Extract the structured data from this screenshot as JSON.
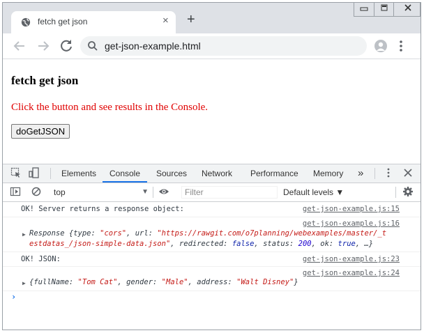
{
  "browser": {
    "tab_title": "fetch get json",
    "url": "get-json-example.html",
    "new_tab_glyph": "+",
    "close_glyph": "×"
  },
  "page": {
    "heading": "fetch get json",
    "instruction": "Click the button and see results in the Console.",
    "button_label": "doGetJSON",
    "instruction_color": "#e00000"
  },
  "devtools": {
    "tabs": [
      "Elements",
      "Console",
      "Sources",
      "Network",
      "Performance",
      "Memory"
    ],
    "active_tab": "Console",
    "more_glyph": "»",
    "context": "top",
    "filter_placeholder": "Filter",
    "levels": "Default levels ▼"
  },
  "console": {
    "rows": [
      {
        "message": "OK! Server returns a response object:",
        "source": "get-json-example.js:15"
      },
      {
        "source": "get-json-example.js:16",
        "line1": {
          "prefix": "Response {",
          "k1": "type: ",
          "v1": "\"cors\"",
          "k2": ", url: ",
          "v2": "\"https://rawgit.com/o7planning/webexamples/master/_t"
        },
        "line2": {
          "v2b": "estdatas_/json-simple-data.json\"",
          "k3": ", redirected: ",
          "v3": "false",
          "k4": ", status: ",
          "v4": "200",
          "k5": ", ok: ",
          "v5": "true",
          "tail": ", …}"
        }
      },
      {
        "message": "OK! JSON:",
        "source": "get-json-example.js:23"
      },
      {
        "source": "get-json-example.js:24",
        "line": {
          "k1": "{fullName: ",
          "v1": "\"Tom Cat\"",
          "k2": ", gender: ",
          "v2": "\"Male\"",
          "k3": ", address: ",
          "v3": "\"Walt Disney\"",
          "tail": "}"
        }
      }
    ],
    "prompt_glyph": "›"
  }
}
